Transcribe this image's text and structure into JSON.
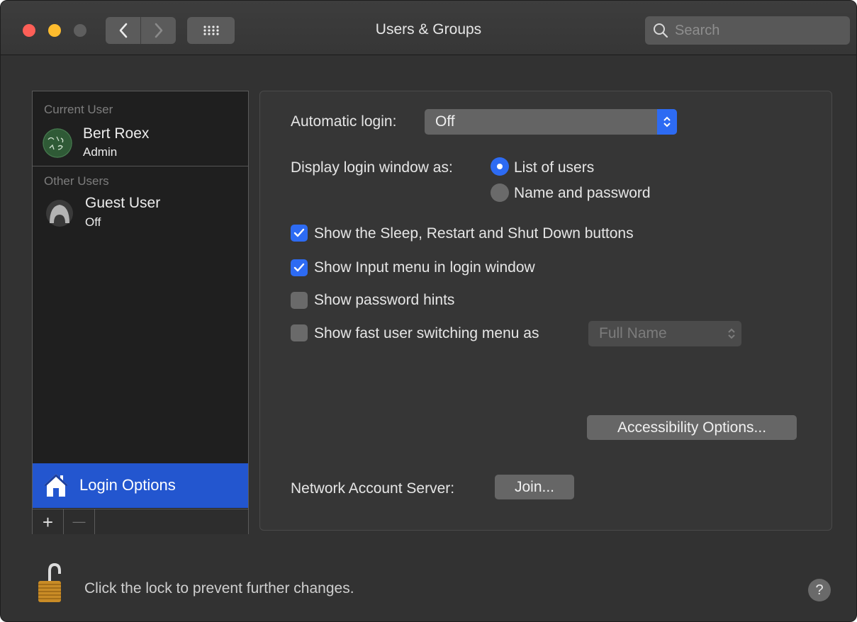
{
  "window": {
    "title": "Users & Groups"
  },
  "toolbar": {
    "search_placeholder": "Search"
  },
  "sidebar": {
    "current_user_header": "Current User",
    "current_user": {
      "name": "Bert Roex",
      "role": "Admin"
    },
    "other_users_header": "Other Users",
    "other_users": [
      {
        "name": "Guest User",
        "status": "Off"
      }
    ],
    "login_options_label": "Login Options",
    "add_label": "+",
    "remove_label": "—"
  },
  "main": {
    "automatic_login_label": "Automatic login:",
    "automatic_login_value": "Off",
    "display_login_label": "Display login window as:",
    "display_options": [
      {
        "label": "List of users",
        "selected": true
      },
      {
        "label": "Name and password",
        "selected": false
      }
    ],
    "checkboxes": [
      {
        "label": "Show the Sleep, Restart and Shut Down buttons",
        "checked": true
      },
      {
        "label": "Show Input menu in login window",
        "checked": true
      },
      {
        "label": "Show password hints",
        "checked": false
      },
      {
        "label": "Show fast user switching menu as",
        "checked": false
      }
    ],
    "fast_user_switching_value": "Full Name",
    "accessibility_button": "Accessibility Options...",
    "network_label": "Network Account Server:",
    "join_button": "Join..."
  },
  "footer": {
    "lock_text": "Click the lock to prevent further changes.",
    "help_label": "?"
  },
  "colors": {
    "accent": "#2d6bf3",
    "selection": "#2356cf",
    "close": "#fe5f57",
    "minimize": "#febc2e"
  }
}
